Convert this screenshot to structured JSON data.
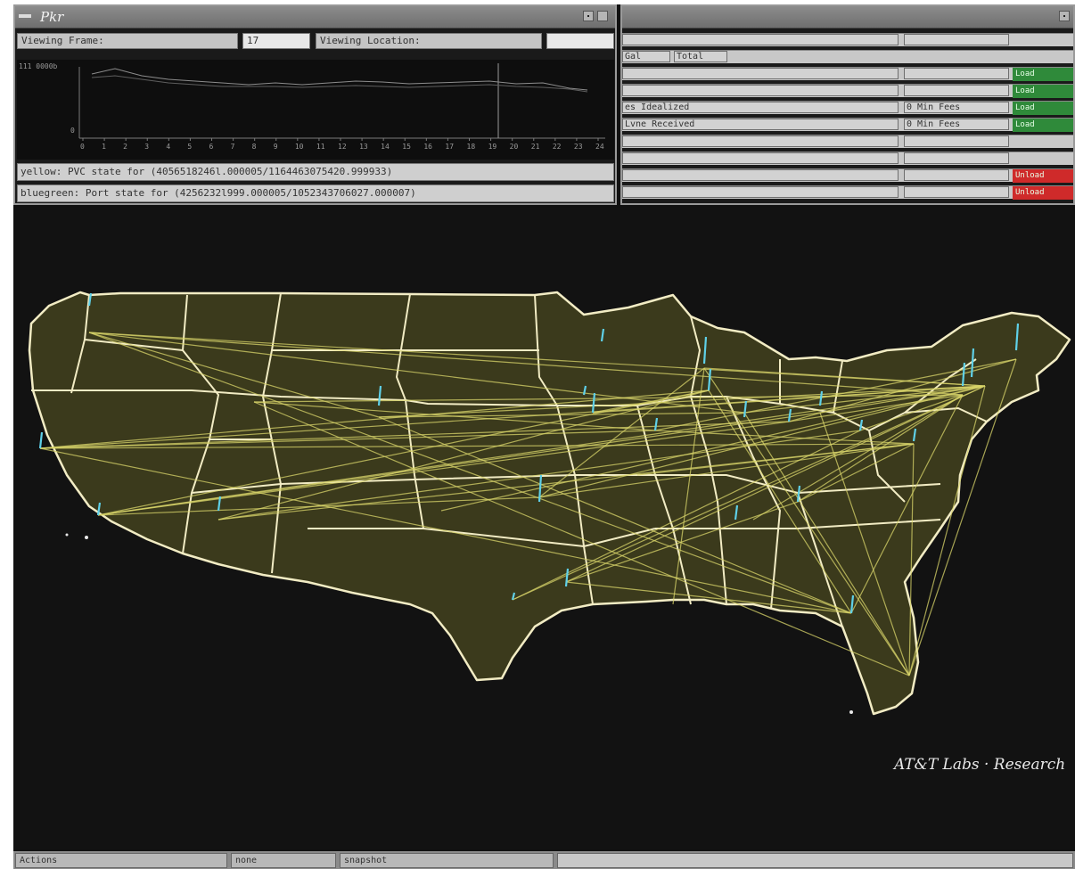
{
  "left_window": {
    "title": "Pkr",
    "viewing_frame_label": "Viewing Frame:",
    "viewing_frame_value": "17",
    "viewing_location_label": "Viewing Location:",
    "viewing_location_value": "",
    "y_axis_max_label": "111 0000b",
    "y_axis_min_label": "0",
    "x_ticks": [
      "0",
      "1",
      "2",
      "3",
      "4",
      "5",
      "6",
      "7",
      "8",
      "9",
      "10",
      "11",
      "12",
      "13",
      "14",
      "15",
      "16",
      "17",
      "18",
      "19",
      "20",
      "21",
      "22",
      "23",
      "24"
    ],
    "status_yellow": "yellow: PVC state for (4056518246l.000005/1164463075420.999933)",
    "status_bluegreen": "bluegreen: Port state for (4256232l999.000005/1052343706027.000007)"
  },
  "right_window": {
    "rows": [
      {
        "label": "",
        "value": "",
        "button": "",
        "button_color": ""
      },
      {
        "label": "Gal",
        "value": "Total",
        "button": "",
        "button_color": ""
      },
      {
        "label": "",
        "value": "",
        "button": "Load",
        "button_color": "#2f8a3a"
      },
      {
        "label": "",
        "value": "",
        "button": "Load",
        "button_color": "#2f8a3a"
      },
      {
        "label": "es Idealized",
        "value": "0 Min Fees",
        "button": "Load",
        "button_color": "#2f8a3a"
      },
      {
        "label": "Lvne Received",
        "value": "0 Min Fees",
        "button": "Load",
        "button_color": "#2f8a3a"
      },
      {
        "label": "",
        "value": "",
        "button": "",
        "button_color": ""
      },
      {
        "label": "",
        "value": "",
        "button": "",
        "button_color": ""
      },
      {
        "label": "",
        "value": "",
        "button": "Unload",
        "button_color": "#cf2a2a"
      },
      {
        "label": "",
        "value": "",
        "button": "Unload",
        "button_color": "#cf2a2a"
      }
    ]
  },
  "watermark": "AT&T Labs · Research",
  "bottom_bar": {
    "actions": "Actions",
    "none": "none",
    "snapshot": "snapshot",
    "status": ""
  },
  "colors": {
    "traffic_line": "#d8d46a",
    "node_marker": "#5fd0e8",
    "state_border": "#f2ecc4",
    "map_fill": "#3b3a1c",
    "background": "#111111"
  }
}
